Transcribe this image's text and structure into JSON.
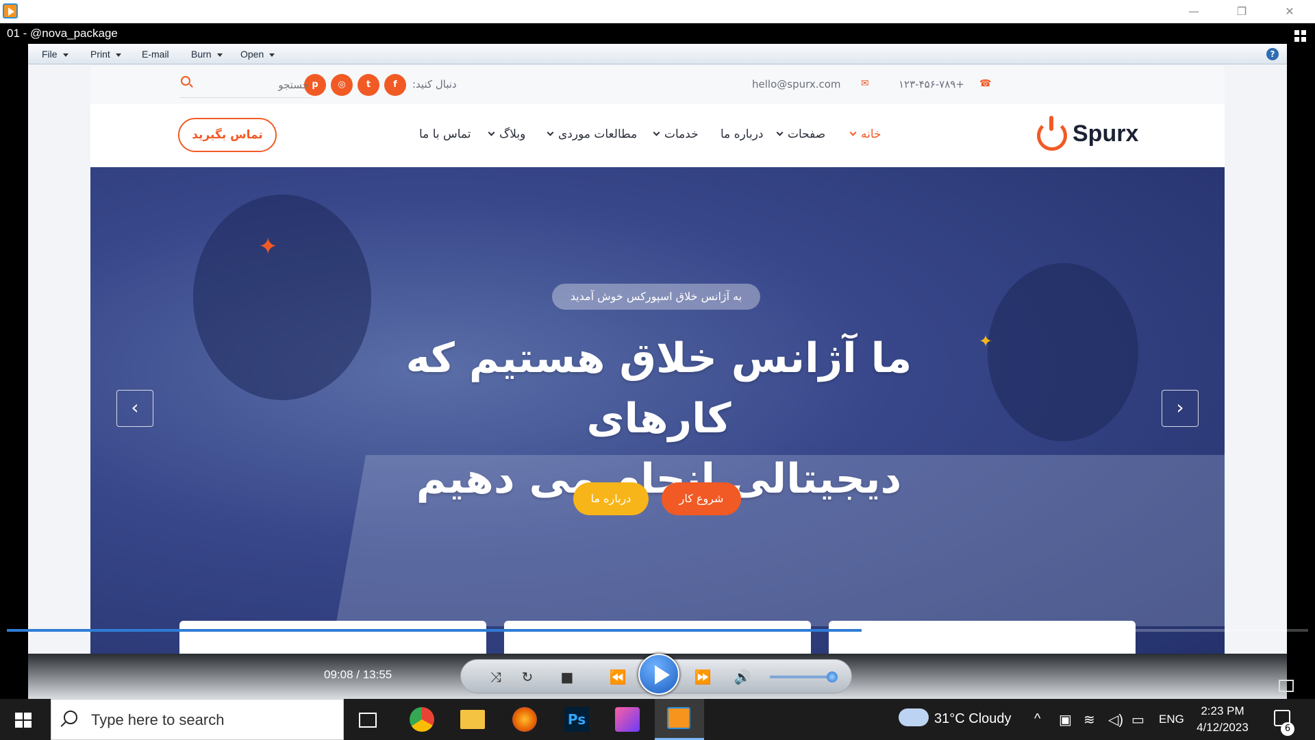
{
  "window": {
    "title": "@nova_package",
    "episode": "01 -"
  },
  "viewer_menu": {
    "items": [
      "File",
      "Print",
      "E-mail",
      "Burn",
      "Open"
    ]
  },
  "site": {
    "topbar": {
      "phone": "+۱۲۳-۴۵۶-۷۸۹",
      "email": "hello@spurx.com",
      "follow_label": "دنبال کنید:",
      "social": [
        "p",
        "ig",
        "tw",
        "f"
      ],
      "search_placeholder": "جستجو"
    },
    "logo_text": "Spurx",
    "nav": [
      {
        "label": "خانه",
        "dropdown": true,
        "active": true
      },
      {
        "label": "صفحات",
        "dropdown": true,
        "active": false
      },
      {
        "label": "درباره ما",
        "dropdown": false,
        "active": false
      },
      {
        "label": "خدمات",
        "dropdown": true,
        "active": false
      },
      {
        "label": "مطالعات موردی",
        "dropdown": true,
        "active": false
      },
      {
        "label": "وبلاگ",
        "dropdown": true,
        "active": false
      },
      {
        "label": "تماس با ما",
        "dropdown": false,
        "active": false
      }
    ],
    "contact_button": "تماس بگیرید",
    "hero": {
      "badge": "به آژانس خلاق اسپورکس خوش آمدید",
      "headline_line1": "ما آژانس خلاق هستیم که کارهای",
      "headline_line2": "دیجیتالی انجام می دهیم",
      "primary_button": "شروع کار",
      "secondary_button": "درباره ما",
      "prev_arrow": "‹",
      "next_arrow": "›"
    }
  },
  "player": {
    "current_time": "09:08",
    "total_time": "13:55",
    "time_display": "09:08 / 13:55",
    "progress": 0.657,
    "volume": 0.9
  },
  "taskbar": {
    "search_placeholder": "Type here to search",
    "weather": "31°C  Cloudy",
    "language": "ENG",
    "time": "2:23 PM",
    "date": "4/12/2023",
    "notifications": "6"
  },
  "colors": {
    "accent": "#f15a24",
    "secondary": "#f8b51a",
    "hero_overlay": "#2f3f84"
  }
}
